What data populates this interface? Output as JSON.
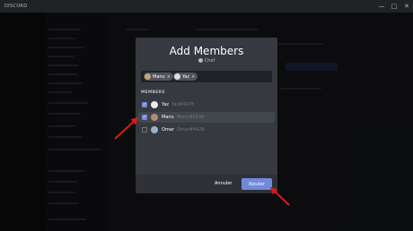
{
  "app": {
    "title": "DISCORD"
  },
  "window_controls": [
    "—",
    "□",
    "✕"
  ],
  "modal": {
    "title": "Add Members",
    "subtitle": "Chef",
    "chips": [
      {
        "name": "Manu",
        "remove": "×"
      },
      {
        "name": "Yaz",
        "remove": "×"
      }
    ],
    "section_label": "MEMBERS",
    "members": [
      {
        "name": "Yaz",
        "tag": "Yaz#4678",
        "checked": true,
        "check_glyph": "✓"
      },
      {
        "name": "Manu",
        "tag": "Manu#6934",
        "checked": true,
        "check_glyph": "✓"
      },
      {
        "name": "Omar",
        "tag": "Omar#4426",
        "checked": false,
        "check_glyph": ""
      }
    ],
    "cancel_label": "Annuler",
    "add_label": "Ajouter"
  },
  "colors": {
    "accent": "#7289da",
    "annotation_arrow": "#d81b1b",
    "modal_bg": "#36393f",
    "footer_bg": "#2f3136"
  }
}
